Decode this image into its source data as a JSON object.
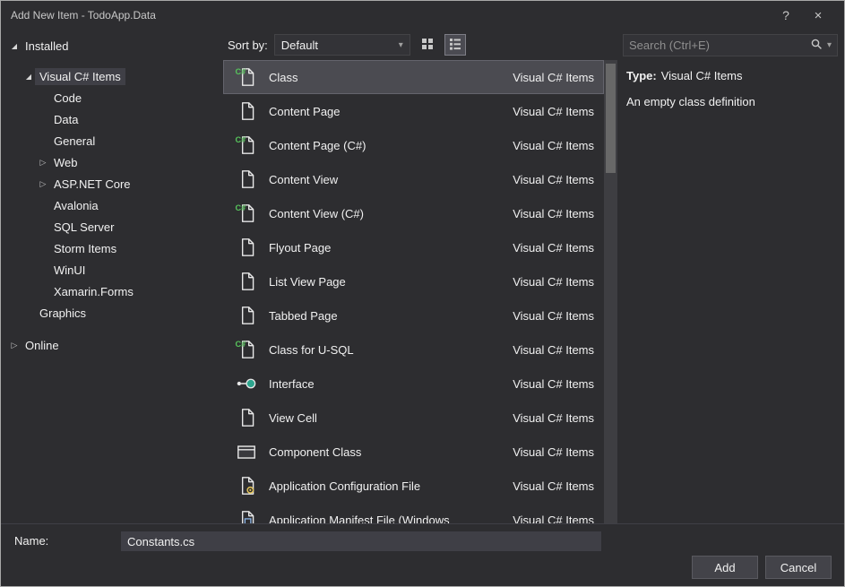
{
  "colors": {
    "window_bg": "#2d2d30",
    "list_selection": "#4b4b51",
    "tree_selection": "#3f3f46",
    "csharp_green": "#57c45c",
    "interface_teal": "#2ea58e",
    "config_yellow": "#e8c85a",
    "manifest_blue": "#8ab4e8",
    "icon_stroke": "#e8e8e8"
  },
  "window": {
    "title": "Add New Item - TodoApp.Data",
    "help_glyph": "?",
    "close_glyph": "×"
  },
  "sidebar": {
    "items": [
      {
        "id": "installed",
        "label": "Installed",
        "level": 0,
        "expand": "expanded",
        "gap": 0
      },
      {
        "id": "visual-csharp-items",
        "label": "Visual C# Items",
        "level": 1,
        "expand": "expanded",
        "selected": true,
        "gap": 10
      },
      {
        "id": "code",
        "label": "Code",
        "level": 2
      },
      {
        "id": "data",
        "label": "Data",
        "level": 2
      },
      {
        "id": "general",
        "label": "General",
        "level": 2
      },
      {
        "id": "web",
        "label": "Web",
        "level": 2,
        "expand": "collapsed"
      },
      {
        "id": "aspnet-core",
        "label": "ASP.NET Core",
        "level": 2,
        "expand": "collapsed"
      },
      {
        "id": "avalonia",
        "label": "Avalonia",
        "level": 2
      },
      {
        "id": "sql-server",
        "label": "SQL Server",
        "level": 2
      },
      {
        "id": "storm-items",
        "label": "Storm Items",
        "level": 2
      },
      {
        "id": "winui",
        "label": "WinUI",
        "level": 2
      },
      {
        "id": "xamarin-forms",
        "label": "Xamarin.Forms",
        "level": 2
      },
      {
        "id": "graphics",
        "label": "Graphics",
        "level": 1
      },
      {
        "id": "online",
        "label": "Online",
        "level": 0,
        "expand": "collapsed",
        "gap": 12
      }
    ]
  },
  "toolbar": {
    "sort_by_label": "Sort by:",
    "sort_value": "Default"
  },
  "search": {
    "placeholder": "Search (Ctrl+E)"
  },
  "list": {
    "items": [
      {
        "name": "Class",
        "category": "Visual C# Items",
        "icon": "csharp-class-icon",
        "selected": true
      },
      {
        "name": "Content Page",
        "category": "Visual C# Items",
        "icon": "document-icon"
      },
      {
        "name": "Content Page (C#)",
        "category": "Visual C# Items",
        "icon": "csharp-class-icon"
      },
      {
        "name": "Content View",
        "category": "Visual C# Items",
        "icon": "document-icon"
      },
      {
        "name": "Content View (C#)",
        "category": "Visual C# Items",
        "icon": "csharp-class-icon"
      },
      {
        "name": "Flyout Page",
        "category": "Visual C# Items",
        "icon": "document-icon"
      },
      {
        "name": "List View Page",
        "category": "Visual C# Items",
        "icon": "document-icon"
      },
      {
        "name": "Tabbed Page",
        "category": "Visual C# Items",
        "icon": "document-icon"
      },
      {
        "name": "Class for U-SQL",
        "category": "Visual C# Items",
        "icon": "csharp-class-icon"
      },
      {
        "name": "Interface",
        "category": "Visual C# Items",
        "icon": "interface-icon"
      },
      {
        "name": "View Cell",
        "category": "Visual C# Items",
        "icon": "document-icon"
      },
      {
        "name": "Component Class",
        "category": "Visual C# Items",
        "icon": "component-icon"
      },
      {
        "name": "Application Configuration File",
        "category": "Visual C# Items",
        "icon": "config-file-icon"
      },
      {
        "name": "Application Manifest File (Windows",
        "category": "Visual C# Items",
        "icon": "manifest-file-icon"
      }
    ]
  },
  "details": {
    "type_label": "Type:",
    "type_value": "Visual C# Items",
    "description": "An empty class definition"
  },
  "footer": {
    "name_label": "Name:",
    "name_value": "Constants.cs",
    "add_label": "Add",
    "cancel_label": "Cancel"
  }
}
